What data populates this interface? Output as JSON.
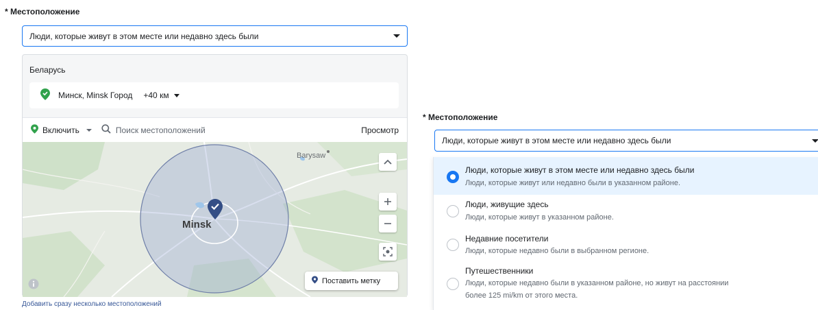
{
  "left": {
    "section_label": "* Местоположение",
    "audience_select_value": "Люди, которые живут в этом месте или недавно здесь были",
    "country": "Беларусь",
    "location": {
      "name": "Минск, Minsk Город",
      "radius": "+40 км"
    },
    "toolbar": {
      "include_label": "Включить",
      "search_placeholder": "Поиск местоположений",
      "browse_label": "Просмотр"
    },
    "map": {
      "city_label": "Minsk",
      "town_label": "Barysaw",
      "drop_pin_label": "Поставить метку",
      "radius_km": 40
    },
    "bulk_link": "Добавить сразу несколько местоположений"
  },
  "right": {
    "section_label": "* Местоположение",
    "select_value": "Люди, которые живут в этом месте или недавно здесь были",
    "options": [
      {
        "title": "Люди, которые живут в этом месте или недавно здесь были",
        "desc": "Люди, которые живут или недавно были в указанном районе.",
        "desc2": "",
        "selected": true
      },
      {
        "title": "Люди, живущие здесь",
        "desc": "Люди, которые живут в указанном районе.",
        "desc2": "",
        "selected": false
      },
      {
        "title": "Недавние посетители",
        "desc": "Люди, которые недавно были в выбранном регионе.",
        "desc2": "",
        "selected": false
      },
      {
        "title": "Путешественники",
        "desc": "Люди, которые недавно были в указанном районе, но живут на расстоянии",
        "desc2": "более 125 mi/km от этого места.",
        "selected": false
      }
    ]
  },
  "colors": {
    "accent": "#1877f2",
    "pin_green": "#31a24c",
    "map_pin": "#344e86"
  },
  "icons": [
    "location-pin-icon",
    "search-icon",
    "chevron-up-icon",
    "zoom-in-icon",
    "zoom-out-icon",
    "recenter-icon",
    "info-icon",
    "map-marker-icon"
  ]
}
